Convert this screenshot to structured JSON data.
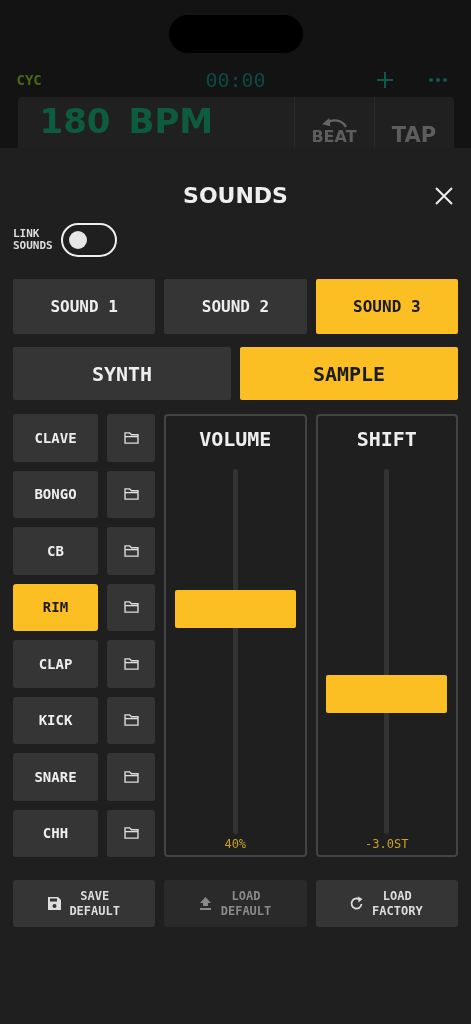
{
  "background": {
    "cycle_label": "CYC",
    "timer": "00:00",
    "tempo": "180",
    "tempo_unit": "BPM",
    "beat_label": "BEAT",
    "tap_label": "TAP"
  },
  "sheet": {
    "title": "SOUNDS",
    "link_sounds": {
      "label": "LINK SOUNDS",
      "on": false
    },
    "sound_tabs": [
      {
        "label": "SOUND 1",
        "selected": false
      },
      {
        "label": "SOUND 2",
        "selected": false
      },
      {
        "label": "SOUND 3",
        "selected": true
      }
    ],
    "mode_tabs": [
      {
        "label": "SYNTH",
        "selected": false
      },
      {
        "label": "SAMPLE",
        "selected": true
      }
    ],
    "samples": [
      {
        "label": "CLAVE",
        "selected": false
      },
      {
        "label": "BONGO",
        "selected": false
      },
      {
        "label": "CB",
        "selected": false
      },
      {
        "label": "RIM",
        "selected": true
      },
      {
        "label": "CLAP",
        "selected": false
      },
      {
        "label": "KICK",
        "selected": false
      },
      {
        "label": "SNARE",
        "selected": false
      },
      {
        "label": "CHH",
        "selected": false
      }
    ],
    "sliders": [
      {
        "title": "VOLUME",
        "level": 0.63,
        "reading": "40%"
      },
      {
        "title": "SHIFT",
        "level": 0.37,
        "reading": "-3.0ST"
      }
    ],
    "actions": [
      {
        "kind": "save",
        "label": "SAVE DEFAULT",
        "disabled": false
      },
      {
        "kind": "load",
        "label": "LOAD DEFAULT",
        "disabled": true
      },
      {
        "kind": "reset",
        "label": "LOAD FACTORY",
        "disabled": false
      }
    ]
  }
}
